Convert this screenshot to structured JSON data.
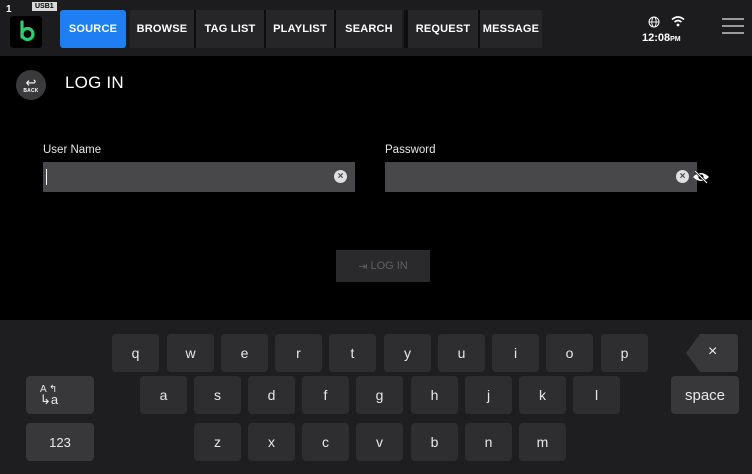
{
  "deck": {
    "number": "1",
    "source": "USB1"
  },
  "tabs": [
    {
      "label": "SOURCE",
      "active": true
    },
    {
      "label": "BROWSE",
      "active": false
    },
    {
      "label": "TAG LIST",
      "active": false
    },
    {
      "label": "PLAYLIST",
      "active": false
    },
    {
      "label": "SEARCH",
      "active": false
    },
    {
      "label": "REQUEST",
      "active": false
    },
    {
      "label": "MESSAGE",
      "active": false
    }
  ],
  "status": {
    "time": "12:08",
    "ampm": "PM",
    "icons": [
      "globe-icon",
      "wifi-icon",
      "menu-icon"
    ]
  },
  "login": {
    "back_label": "BACK",
    "title": "LOG IN",
    "username_label": "User Name",
    "username_value": "",
    "password_label": "Password",
    "password_value": "",
    "submit_label": "LOG IN"
  },
  "keyboard": {
    "row1": [
      "q",
      "w",
      "e",
      "r",
      "t",
      "y",
      "u",
      "i",
      "o",
      "p"
    ],
    "row2": [
      "a",
      "s",
      "d",
      "f",
      "g",
      "h",
      "j",
      "k",
      "l"
    ],
    "row3": [
      "z",
      "x",
      "c",
      "v",
      "b",
      "n",
      "m"
    ],
    "shift_top": "A",
    "shift_bottom": "a",
    "backspace": "×",
    "space": "space",
    "numbers": "123"
  },
  "colors": {
    "accent": "#1f7ff2",
    "logo": "#2ecc71",
    "bar": "#1c1c1e",
    "field": "#48484a"
  }
}
